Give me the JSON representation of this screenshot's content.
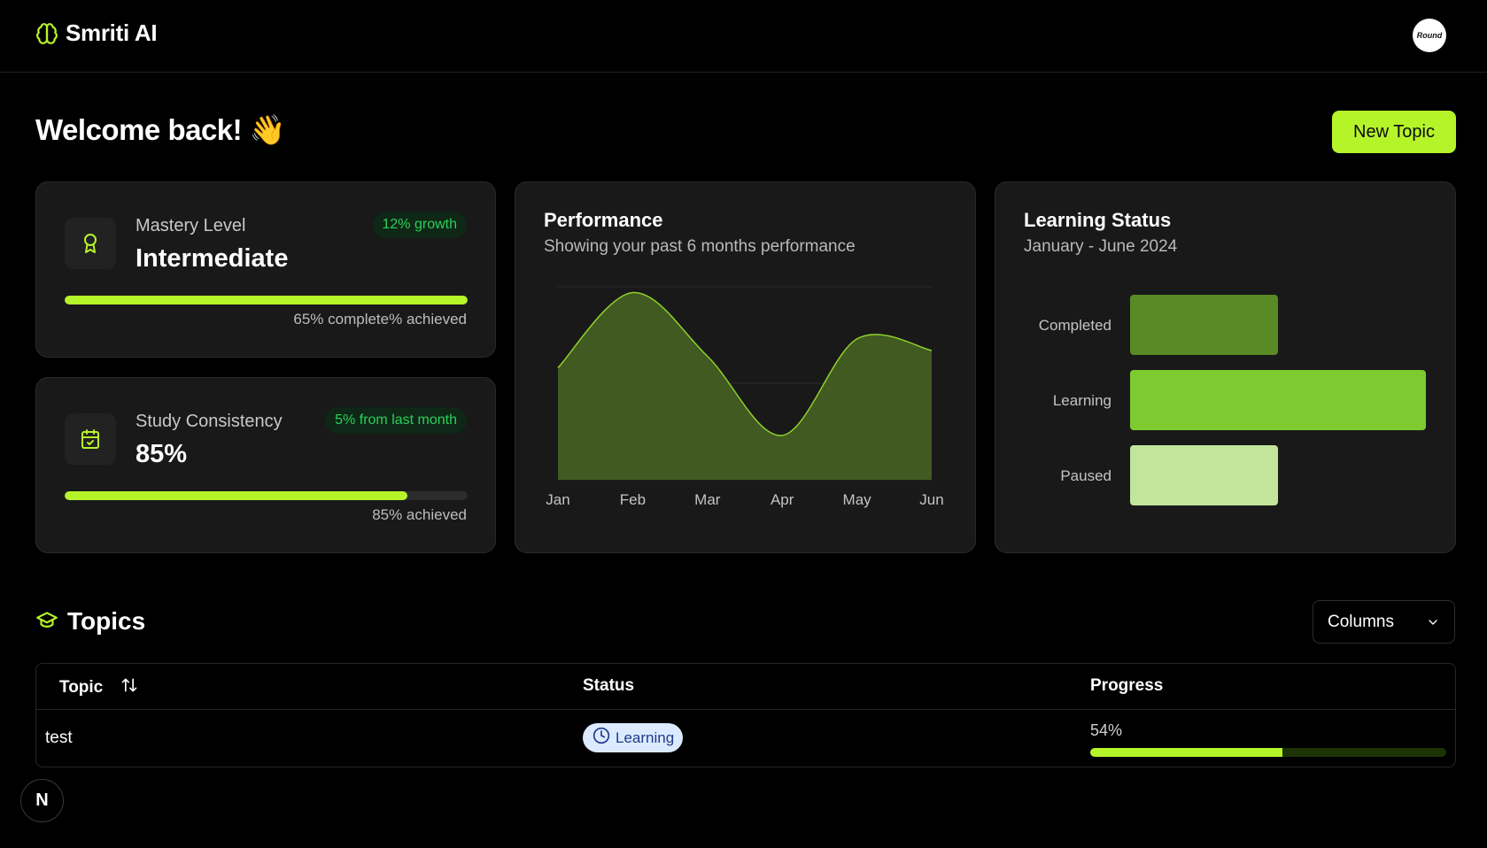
{
  "app": {
    "name": "Smriti AI",
    "brand_icon": "brain-icon",
    "avatar_text": "Round"
  },
  "header": {
    "welcome": "Welcome back! 👋",
    "new_topic_label": "New Topic"
  },
  "mastery": {
    "label": "Mastery Level",
    "value": "Intermediate",
    "badge": "12% growth",
    "progress": 1.0,
    "caption": "65% complete% achieved",
    "icon": "award-icon"
  },
  "study": {
    "label": "Study Consistency",
    "value": "85%",
    "badge": "5% from last month",
    "progress": 0.85,
    "caption": "85% achieved",
    "icon": "calendar-check-icon"
  },
  "performance": {
    "title": "Performance",
    "subtitle": "Showing your past 6 months performance"
  },
  "learning_status": {
    "title": "Learning Status",
    "subtitle": "January - June 2024"
  },
  "chart_data": [
    {
      "type": "area",
      "title": "Performance",
      "subtitle": "Showing your past 6 months performance",
      "x": [
        "Jan",
        "Feb",
        "Mar",
        "Apr",
        "May",
        "Jun"
      ],
      "values": [
        58,
        97,
        64,
        23,
        73,
        67
      ],
      "ylim": [
        0,
        100
      ],
      "grid": true,
      "colors": {
        "fill": "#435e22",
        "stroke": "#8fd12b"
      }
    },
    {
      "type": "bar",
      "orientation": "horizontal",
      "title": "Learning Status",
      "subtitle": "January - June 2024",
      "categories": [
        "Completed",
        "Learning",
        "Paused"
      ],
      "values": [
        1,
        2,
        1
      ],
      "colors": [
        "#5a8a23",
        "#7ecb31",
        "#c1e59a"
      ]
    }
  ],
  "topics": {
    "title": "Topics",
    "columns_label": "Columns",
    "headers": {
      "topic": "Topic",
      "status": "Status",
      "progress": "Progress"
    },
    "rows": [
      {
        "topic": "test",
        "status": "Learning",
        "progress_label": "54%",
        "progress": 0.54
      }
    ]
  },
  "colors": {
    "accent": "#b6f42a",
    "card": "#191919",
    "badge_text": "#2bd15a"
  },
  "floating": {
    "next_label": "N"
  }
}
